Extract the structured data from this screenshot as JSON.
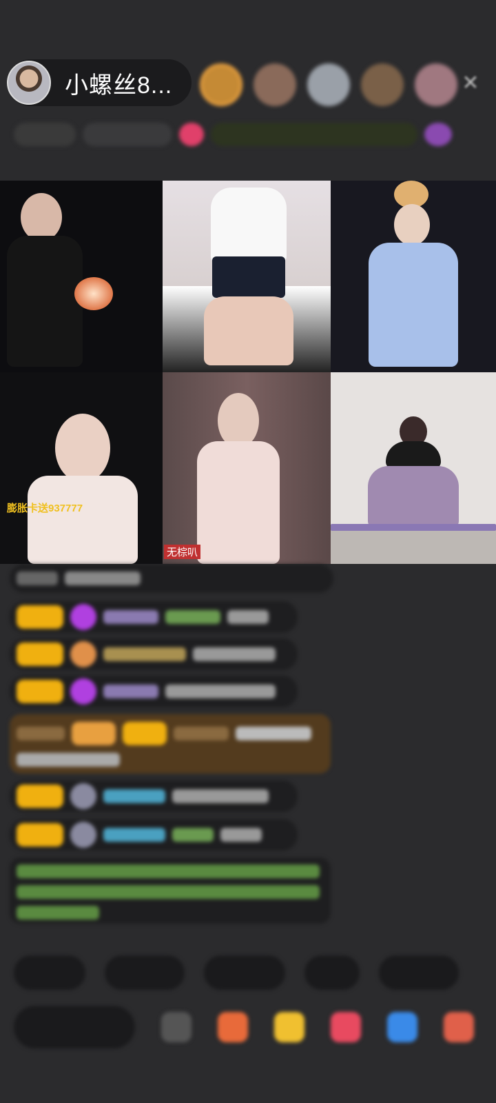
{
  "header": {
    "host_name": "小螺丝8..."
  },
  "grid": {
    "tile_labels": [
      "膨胀卡送937777",
      "无棕叭"
    ]
  },
  "colors": {
    "background": "#2b2b2d",
    "badge_gold": "#f0b010",
    "system_text_green": "#7fd35a"
  },
  "icons": {
    "close": "close-icon",
    "comment": "comment-icon",
    "gift": "gift-icon"
  }
}
